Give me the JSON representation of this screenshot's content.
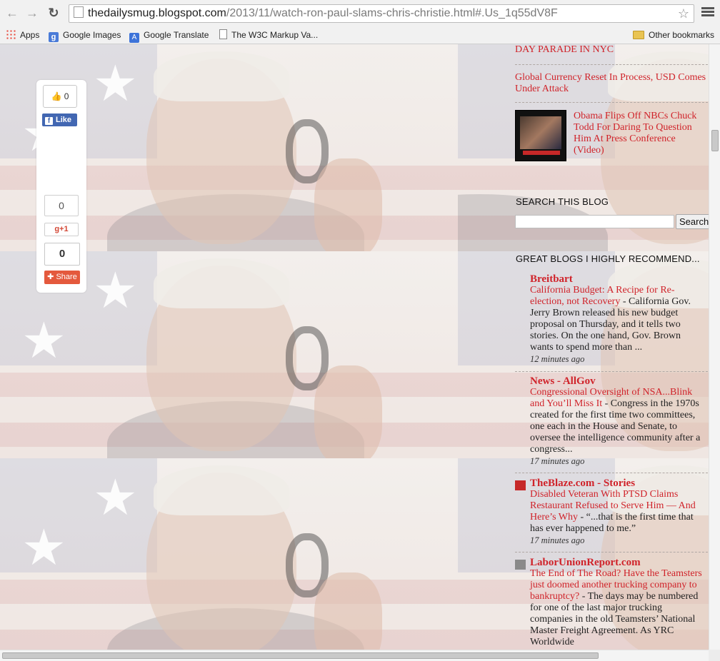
{
  "browser": {
    "url_domain": "thedailysmug.blogspot.com",
    "url_path": "/2013/11/watch-ron-paul-slams-chris-christie.html#.Us_1q55dV8F",
    "bookmarks": [
      {
        "label": "Apps",
        "icon": "apps-grid-icon"
      },
      {
        "label": "Google Images",
        "icon": "google-icon"
      },
      {
        "label": "Google Translate",
        "icon": "translate-icon"
      },
      {
        "label": "The W3C Markup Va...",
        "icon": "document-icon"
      }
    ],
    "other_bookmarks": "Other bookmarks"
  },
  "share_widget": {
    "facebook_count": "0",
    "facebook_like": "Like",
    "gplus_count": "0",
    "gplus_button": "+1",
    "share_count": "0",
    "share_button": "Share"
  },
  "sidebar": {
    "top_links": [
      "DAY PARADE IN NYC",
      "Global Currency Reset In Process, USD Comes Under Attack",
      "Obama Flips Off NBCs Chuck Todd For Daring To Question Him At Press Conference (Video)"
    ],
    "search_heading": "SEARCH THIS BLOG",
    "search_placeholder": "",
    "search_button": "Search",
    "blogs_heading": "GREAT BLOGS I HIGHLY RECOMMEND...",
    "blogs": [
      {
        "name": "Breitbart",
        "title": "California Budget: A Recipe for Re-election, not Recovery",
        "snippet": " - California Gov. Jerry Brown released his new budget proposal on Thursday, and it tells two stories. On the one hand, Gov. Brown wants to spend more than ...",
        "ago": "12 minutes ago"
      },
      {
        "name": "News - AllGov",
        "title": "Congressional Oversight of NSA...Blink and You’ll Miss It",
        "snippet": " - Congress in the 1970s created for the first time two committees, one each in the House and Senate, to oversee the intelligence community after a congress...",
        "ago": "17 minutes ago"
      },
      {
        "name": "TheBlaze.com - Stories",
        "title": "Disabled Veteran With PTSD Claims Restaurant Refused to Serve Him — And Here’s Why",
        "snippet": " - “...that is the first time that has ever happened to me.”",
        "ago": "17 minutes ago"
      },
      {
        "name": "LaborUnionReport.com",
        "title": "The End of The Road? Have the Teamsters just doomed another trucking company to bankruptcy?",
        "snippet": " - The days may be numbered for one of the last major trucking companies in the old Teamsters’ National Master Freight Agreement. As YRC Worldwide",
        "ago": ""
      }
    ]
  }
}
